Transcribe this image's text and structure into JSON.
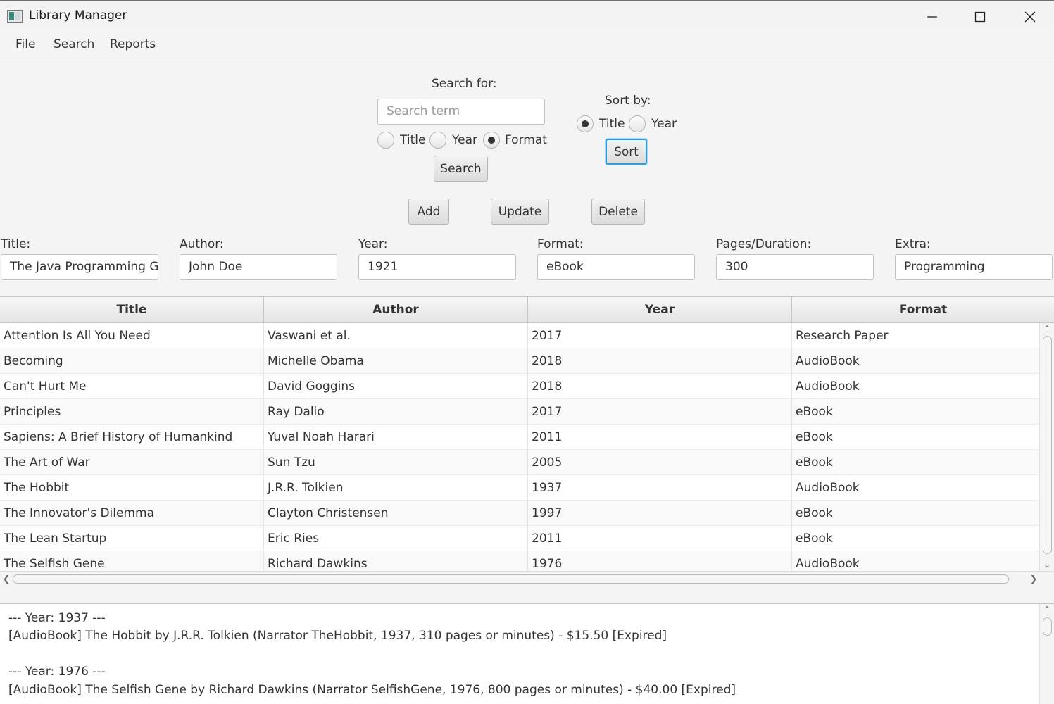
{
  "window": {
    "title": "Library Manager"
  },
  "menu": [
    "File",
    "Search",
    "Reports"
  ],
  "search": {
    "heading": "Search for:",
    "placeholder": "Search term",
    "options": [
      "Title",
      "Year",
      "Format"
    ],
    "selected": "Format",
    "button": "Search"
  },
  "sort": {
    "heading": "Sort by:",
    "options": [
      "Title",
      "Year"
    ],
    "selected": "Title",
    "button": "Sort"
  },
  "actions": {
    "add": "Add",
    "update": "Update",
    "delete": "Delete"
  },
  "form": {
    "title_label": "Title:",
    "title_value": "The Java Programming Gu",
    "author_label": "Author:",
    "author_value": "John Doe",
    "year_label": "Year:",
    "year_value": "1921",
    "format_label": "Format:",
    "format_value": "eBook",
    "pages_label": "Pages/Duration:",
    "pages_value": "300",
    "extra_label": "Extra:",
    "extra_value": "Programming"
  },
  "table": {
    "columns": [
      "Title",
      "Author",
      "Year",
      "Format"
    ],
    "rows": [
      [
        "Attention Is All You Need",
        "Vaswani et al.",
        "2017",
        "Research Paper"
      ],
      [
        "Becoming",
        "Michelle Obama",
        "2018",
        "AudioBook"
      ],
      [
        "Can't Hurt Me",
        "David Goggins",
        "2018",
        "AudioBook"
      ],
      [
        "Principles",
        "Ray Dalio",
        "2017",
        "eBook"
      ],
      [
        "Sapiens: A Brief History of Humankind",
        "Yuval Noah Harari",
        "2011",
        "eBook"
      ],
      [
        "The Art of War",
        "Sun Tzu",
        "2005",
        "eBook"
      ],
      [
        "The Hobbit",
        "J.R.R. Tolkien",
        "1937",
        "AudioBook"
      ],
      [
        "The Innovator's Dilemma",
        "Clayton Christensen",
        "1997",
        "eBook"
      ],
      [
        "The Lean Startup",
        "Eric Ries",
        "2011",
        "eBook"
      ],
      [
        "The Selfish Gene",
        "Richard Dawkins",
        "1976",
        "AudioBook"
      ]
    ]
  },
  "output": {
    "lines": [
      "--- Year: 1937 ---",
      "[AudioBook] The Hobbit by J.R.R. Tolkien (Narrator TheHobbit, 1937, 310 pages or minutes) - $15.50 [Expired]",
      "",
      "--- Year: 1976 ---",
      "[AudioBook] The Selfish Gene by Richard Dawkins (Narrator SelfishGene, 1976, 800 pages or minutes) - $40.00 [Expired]"
    ]
  }
}
